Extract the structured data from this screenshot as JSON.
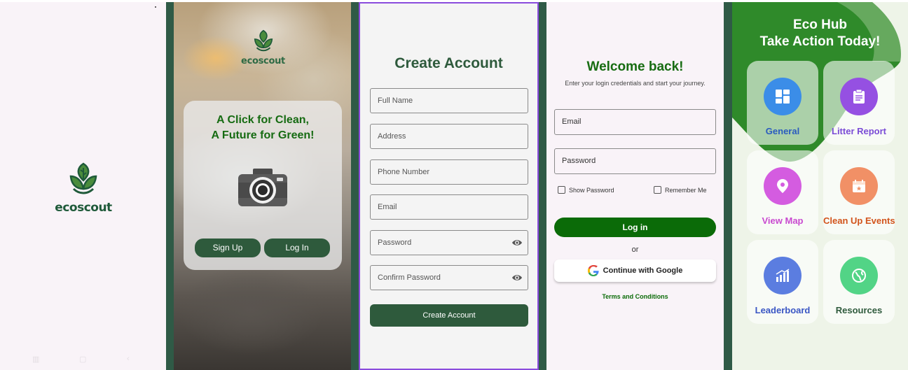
{
  "splash": {
    "brand": "ecoscout"
  },
  "welcome": {
    "brand": "ecoscout",
    "tagline_line1": "A Click for Clean,",
    "tagline_line2": "A Future for Green!",
    "signup_label": "Sign Up",
    "login_label": "Log In"
  },
  "create_account": {
    "title": "Create Account",
    "fields": {
      "full_name": "Full Name",
      "address": "Address",
      "phone": "Phone Number",
      "email": "Email",
      "password": "Password",
      "confirm_password": "Confirm Password"
    },
    "submit_label": "Create Account"
  },
  "login": {
    "title": "Welcome back!",
    "subtitle": "Enter your login credentials and start your journey.",
    "email_placeholder": "Email",
    "password_placeholder": "Password",
    "show_password_label": "Show Password",
    "remember_me_label": "Remember Me",
    "login_label": "Log in",
    "or_label": "or",
    "google_label": "Continue with Google",
    "terms_label": "Terms and Conditions"
  },
  "hub": {
    "title_line1": "Eco Hub",
    "title_line2": "Take Action Today!",
    "tiles": [
      {
        "label": "General",
        "color": "#2a5bbf"
      },
      {
        "label": "Litter Report",
        "color": "#7a4bd6"
      },
      {
        "label": "View Map",
        "color": "#c94ad0"
      },
      {
        "label": "Clean Up Events",
        "color": "#d2541c"
      },
      {
        "label": "Leaderboard",
        "color": "#3a56c4"
      },
      {
        "label": "Resources",
        "color": "#2e5a3c"
      }
    ]
  },
  "colors": {
    "brand_green": "#2e5a3c",
    "accent_green": "#176c12",
    "sidebar_green": "#2f5a46",
    "focus_purple": "#8a4bdc"
  }
}
